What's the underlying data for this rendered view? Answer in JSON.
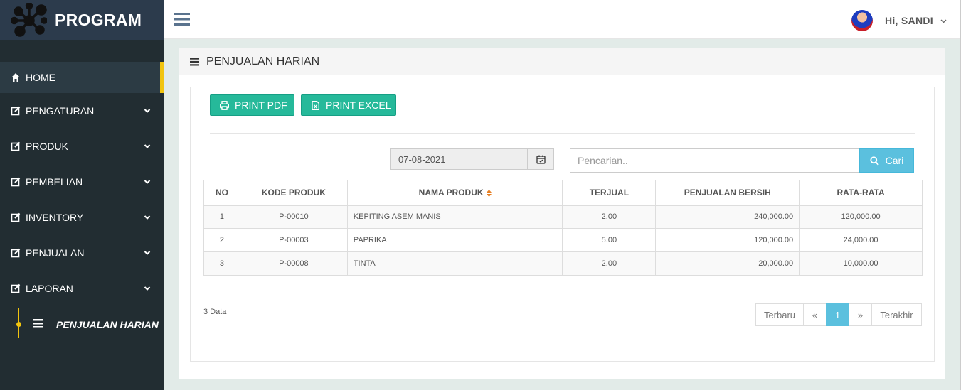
{
  "brand": {
    "name": "PROGRAM",
    "logo_icon": "molecule-logo-icon"
  },
  "sidebar": {
    "items": [
      {
        "label": "HOME",
        "icon": "home-icon",
        "active": true
      },
      {
        "label": "PENGATURAN",
        "icon": "edit-icon"
      },
      {
        "label": "PRODUK",
        "icon": "edit-icon"
      },
      {
        "label": "PEMBELIAN",
        "icon": "edit-icon"
      },
      {
        "label": "INVENTORY",
        "icon": "edit-icon"
      },
      {
        "label": "PENJUALAN",
        "icon": "edit-icon"
      },
      {
        "label": "LAPORAN",
        "icon": "edit-icon"
      }
    ],
    "subitem": {
      "label": "PENJUALAN HARIAN",
      "icon": "list-icon"
    },
    "accent": "#f1c40f"
  },
  "topbar": {
    "greeting": "Hi, SANDI"
  },
  "panel": {
    "title": "PENJUALAN HARIAN"
  },
  "toolbar": {
    "print_pdf": "PRINT PDF",
    "print_excel": "PRINT EXCEL"
  },
  "filter": {
    "date": "07-08-2021",
    "search_placeholder": "Pencarian..",
    "search_button": "Cari"
  },
  "table": {
    "headers": [
      "NO",
      "KODE PRODUK",
      "NAMA PRODUK",
      "TERJUAL",
      "PENJUALAN BERSIH",
      "RATA-RATA"
    ],
    "rows": [
      [
        "1",
        "P-00010",
        "KEPITING ASEM MANIS",
        "2.00",
        "240,000.00",
        "120,000.00"
      ],
      [
        "2",
        "P-00003",
        "PAPRIKA",
        "5.00",
        "120,000.00",
        "24,000.00"
      ],
      [
        "3",
        "P-00008",
        "TINTA",
        "2.00",
        "20,000.00",
        "10,000.00"
      ]
    ]
  },
  "footer": {
    "count_text": "3 Data"
  },
  "pagination": {
    "first": "Terbaru",
    "prev": "«",
    "current": "1",
    "next": "»",
    "last": "Terakhir"
  },
  "colors": {
    "green": "#26b99a",
    "info": "#5bc0de",
    "sidebar": "#222d32"
  }
}
